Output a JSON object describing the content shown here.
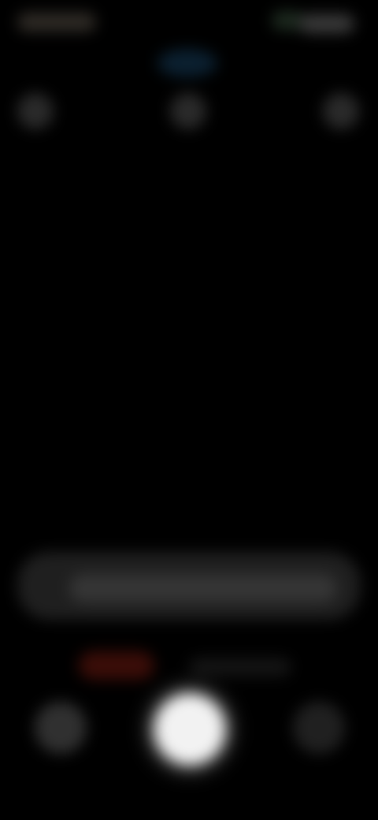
{
  "colors": {
    "background": "#000000",
    "shutter": "#f2f2f2",
    "mode_active": "#3a0d08",
    "camera_indicator": "#0b2030"
  },
  "icons": {
    "status_left": "status-time-icon",
    "status_right": "battery-icon",
    "camera_indicator": "camera-in-use-icon",
    "top_controls": [
      "flash-icon",
      "timer-icon",
      "settings-icon"
    ],
    "gallery": "gallery-thumbnail-icon",
    "shutter": "shutter-button-icon",
    "switch_camera": "switch-camera-icon"
  }
}
